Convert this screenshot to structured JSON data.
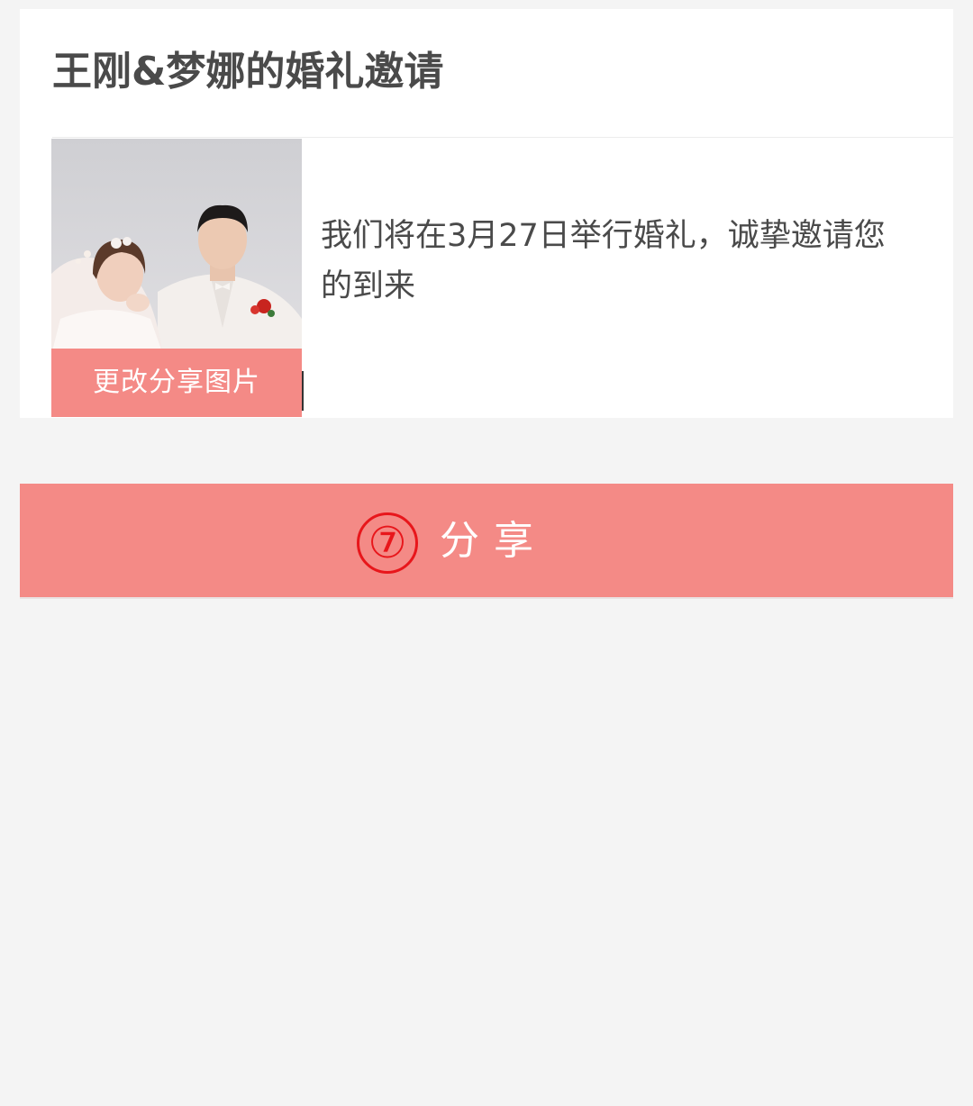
{
  "card": {
    "title": "王刚&梦娜的婚礼邀请",
    "share_image": {
      "change_label": "更改分享图片"
    },
    "description": "我们将在3月27日举行婚礼，诚挚邀请您的到来"
  },
  "share_button": {
    "number_badge": "⑦",
    "label": "分享"
  },
  "colors": {
    "accent": "#f48a86",
    "page_background": "#f4f4f4",
    "badge_red": "#e8161b"
  }
}
